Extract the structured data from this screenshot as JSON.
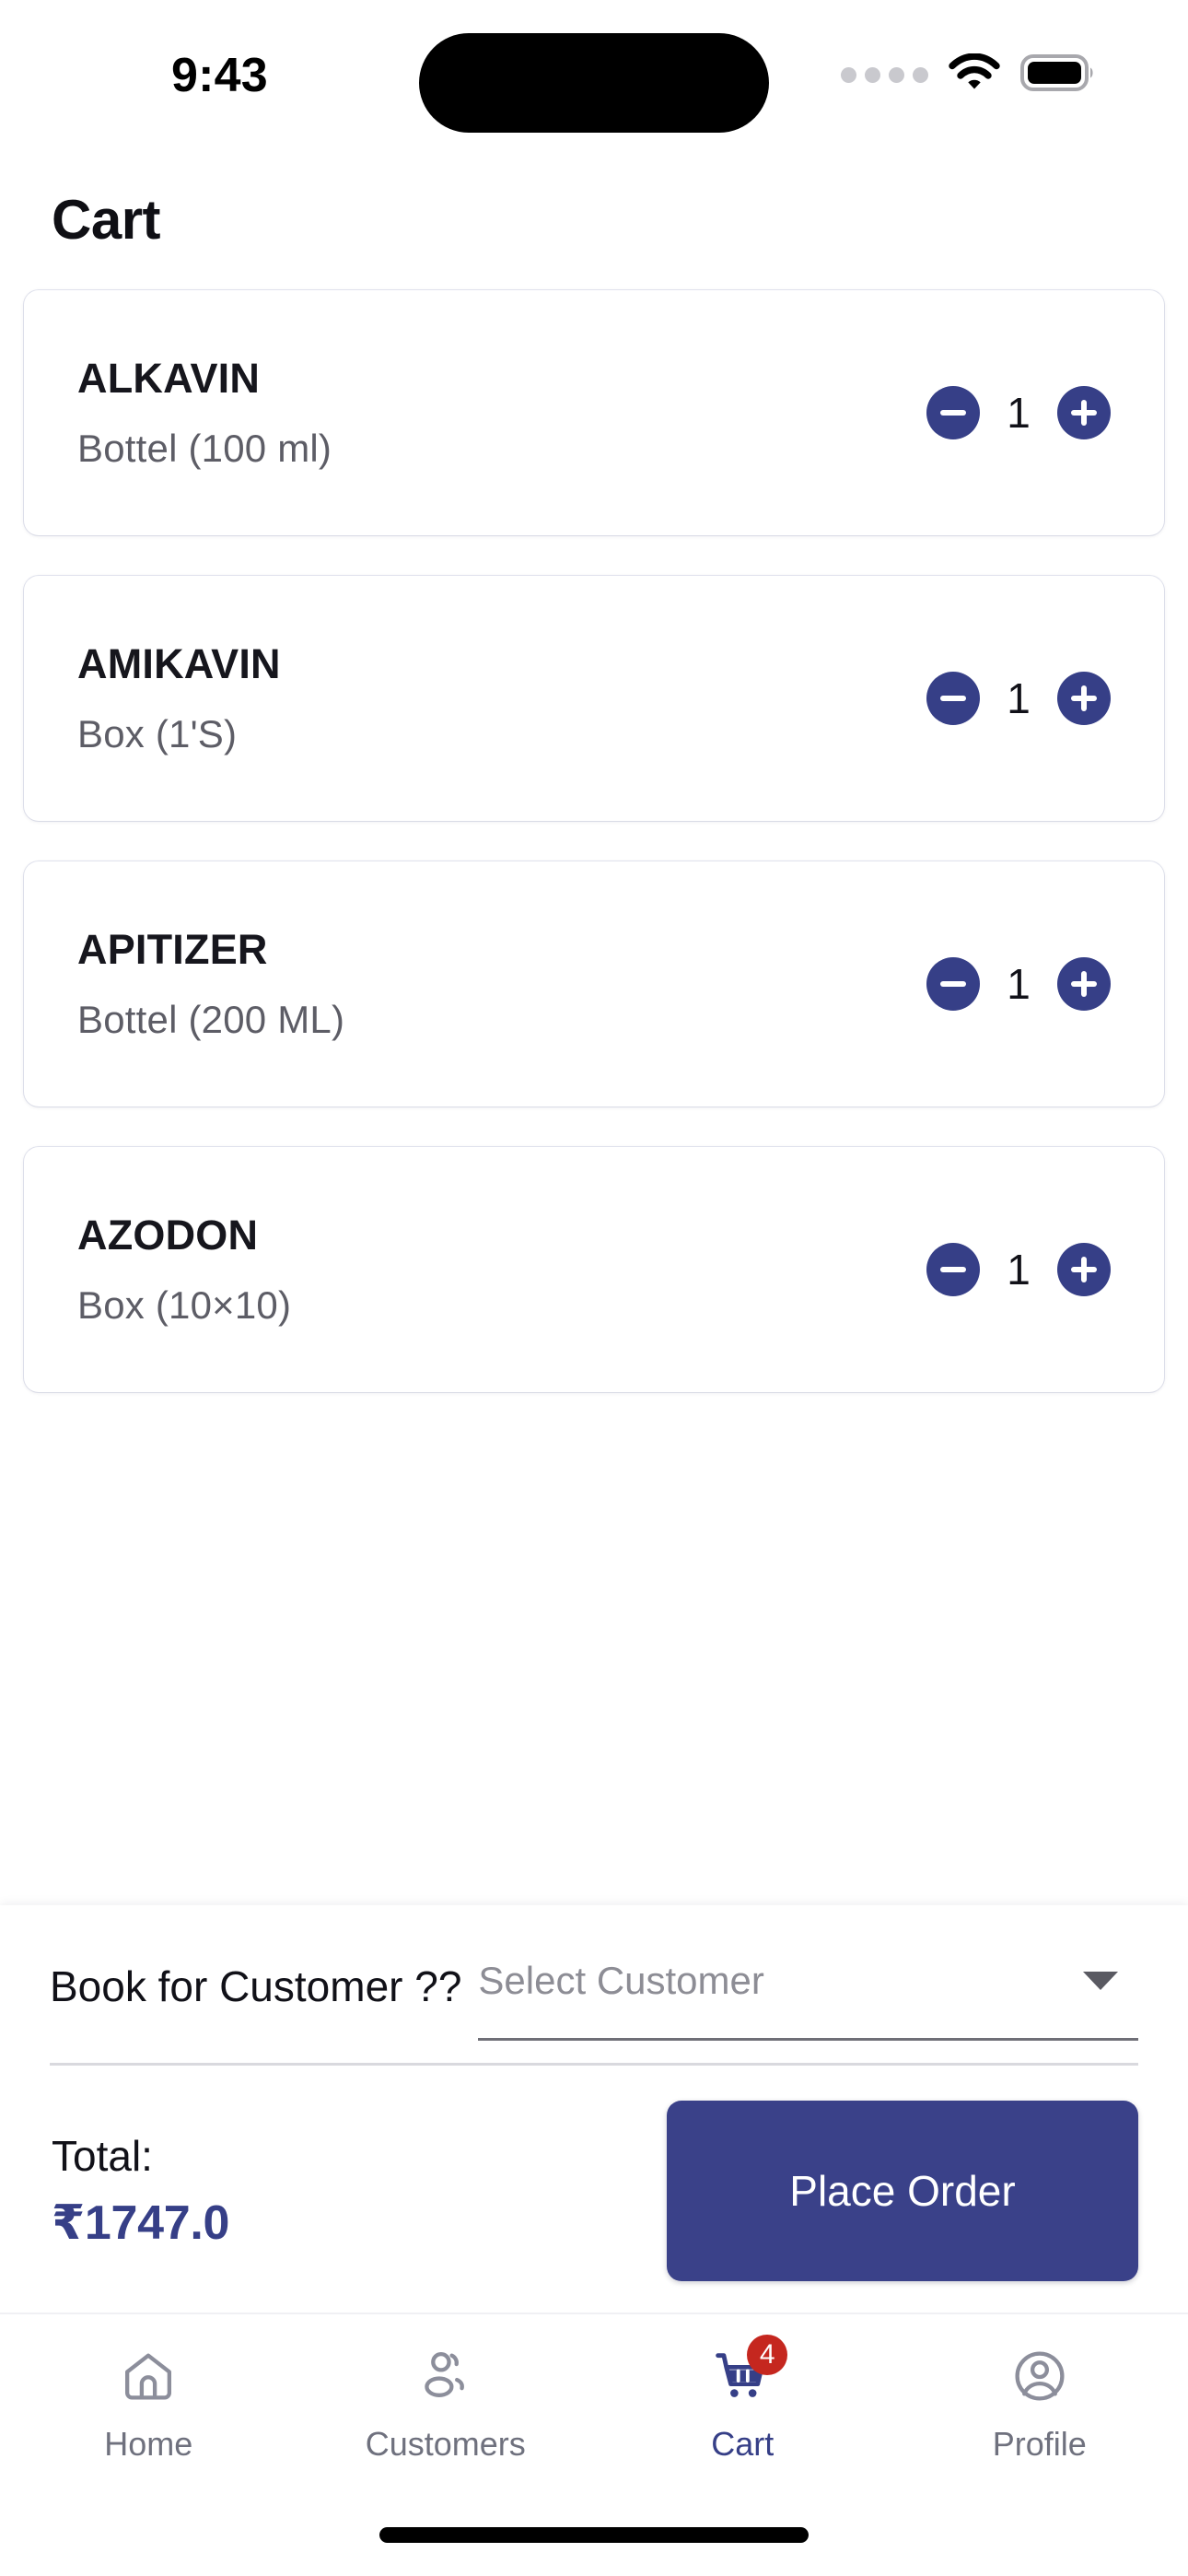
{
  "status_bar": {
    "time": "9:43",
    "icons": [
      "cellular-dots",
      "wifi-icon",
      "battery-icon"
    ]
  },
  "header": {
    "title": "Cart"
  },
  "cart": {
    "items": [
      {
        "name": "ALKAVIN",
        "pack": "Bottel  (100 ml)",
        "quantity": "1",
        "decrement_label": "−",
        "increment_label": "+"
      },
      {
        "name": "AMIKAVIN",
        "pack": "Box  (1'S)",
        "quantity": "1",
        "decrement_label": "−",
        "increment_label": "+"
      },
      {
        "name": "APITIZER",
        "pack": "Bottel  (200 ML)",
        "quantity": "1",
        "decrement_label": "−",
        "increment_label": "+"
      },
      {
        "name": "AZODON",
        "pack": "Box  (10×10)",
        "quantity": "1",
        "decrement_label": "−",
        "increment_label": "+"
      }
    ]
  },
  "checkout": {
    "book_label": "Book for Customer ??",
    "customer_placeholder": "Select Customer",
    "customer_value": "",
    "total_label": "Total:",
    "total_amount": "₹1747.0",
    "place_order_label": "Place Order"
  },
  "tabbar": {
    "tabs": [
      {
        "label": "Home",
        "icon": "home-icon",
        "active": false,
        "badge": ""
      },
      {
        "label": "Customers",
        "icon": "users-icon",
        "active": false,
        "badge": ""
      },
      {
        "label": "Cart",
        "icon": "cart-icon",
        "active": true,
        "badge": "4"
      },
      {
        "label": "Profile",
        "icon": "profile-icon",
        "active": false,
        "badge": ""
      }
    ]
  },
  "colors": {
    "accent_navy": "#363f87",
    "button_navy": "#3a4189",
    "badge_red": "#c5271f",
    "muted_text": "#5d5d66",
    "tab_inactive": "#6f717e"
  }
}
